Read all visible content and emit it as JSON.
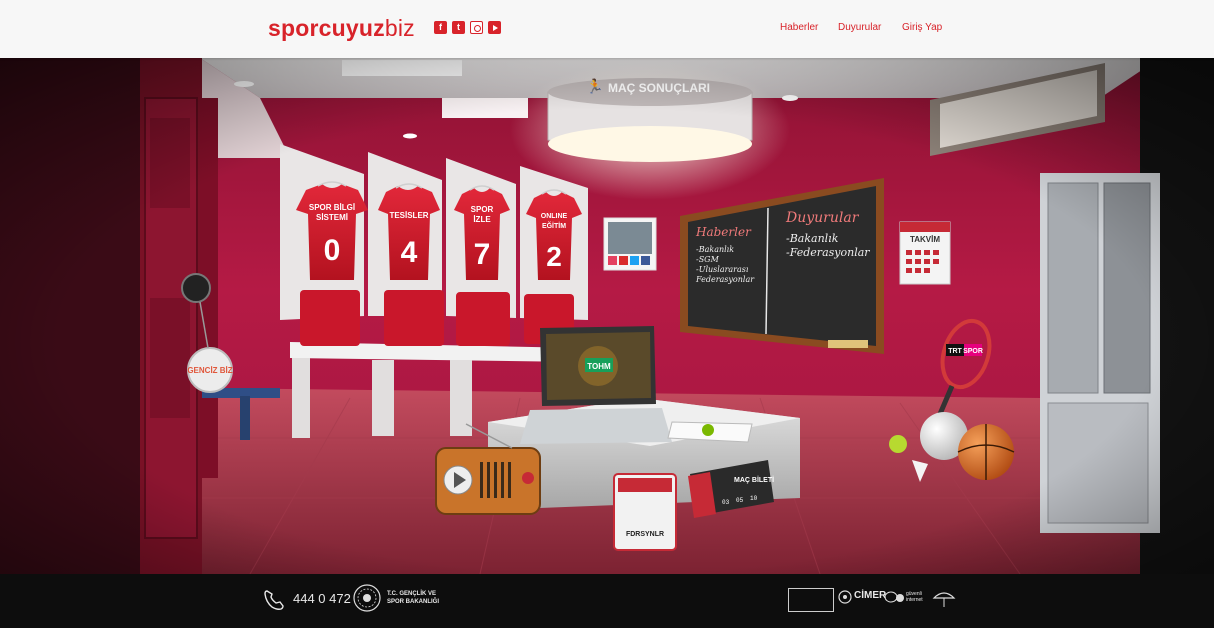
{
  "header": {
    "logo_bold": "sporcuyuz",
    "logo_light": "biz",
    "social": [
      "facebook-icon",
      "twitter-icon",
      "instagram-icon",
      "youtube-icon"
    ],
    "nav": [
      "Haberler",
      "Duyurular",
      "Giriş Yap"
    ]
  },
  "scene": {
    "lamp_label": "MAÇ SONUÇLARI",
    "jerseys": [
      {
        "title": "SPOR BİLGİ SİSTEMİ",
        "line1": "SPOR BİLGİ",
        "line2": "SİSTEMİ",
        "number": "0"
      },
      {
        "title": "TESİSLER",
        "line1": "TESİSLER",
        "line2": "",
        "number": "4"
      },
      {
        "title": "SPOR İZLE",
        "line1": "SPOR",
        "line2": "İZLE",
        "number": "7"
      },
      {
        "title": "ONLINE EĞİTİM",
        "line1": "ONLINE",
        "line2": "EĞİTİM",
        "number": "2"
      }
    ],
    "chalkboard": {
      "left_title": "Haberler",
      "left_items": [
        "-Bakanlık",
        "-SGM",
        "-Uluslararası",
        "Federasyonlar"
      ],
      "right_title": "Duyurular",
      "right_items": [
        "-Bakanlık",
        "-Federasyonlar"
      ]
    },
    "calendar": "TAKVİM",
    "keychain": "GENCİZ BİZ",
    "laptop": "TOHM",
    "trt": [
      "TRT",
      "SPOR"
    ],
    "ticket_title": "MAÇ BİLETİ",
    "ticket_digits": [
      "03",
      "05",
      "10"
    ],
    "badge": "FDRSYNLR"
  },
  "footer": {
    "phone": "444 0 472",
    "ministry_line1": "T.C. GENÇLİK VE",
    "ministry_line2": "SPOR BAKANLIĞI",
    "cimer": "CİMER",
    "guvenli": "güvenli internet"
  },
  "colors": {
    "brand": "#d8232a",
    "wall": "#b01842",
    "chalk": "#2c2c2c"
  }
}
